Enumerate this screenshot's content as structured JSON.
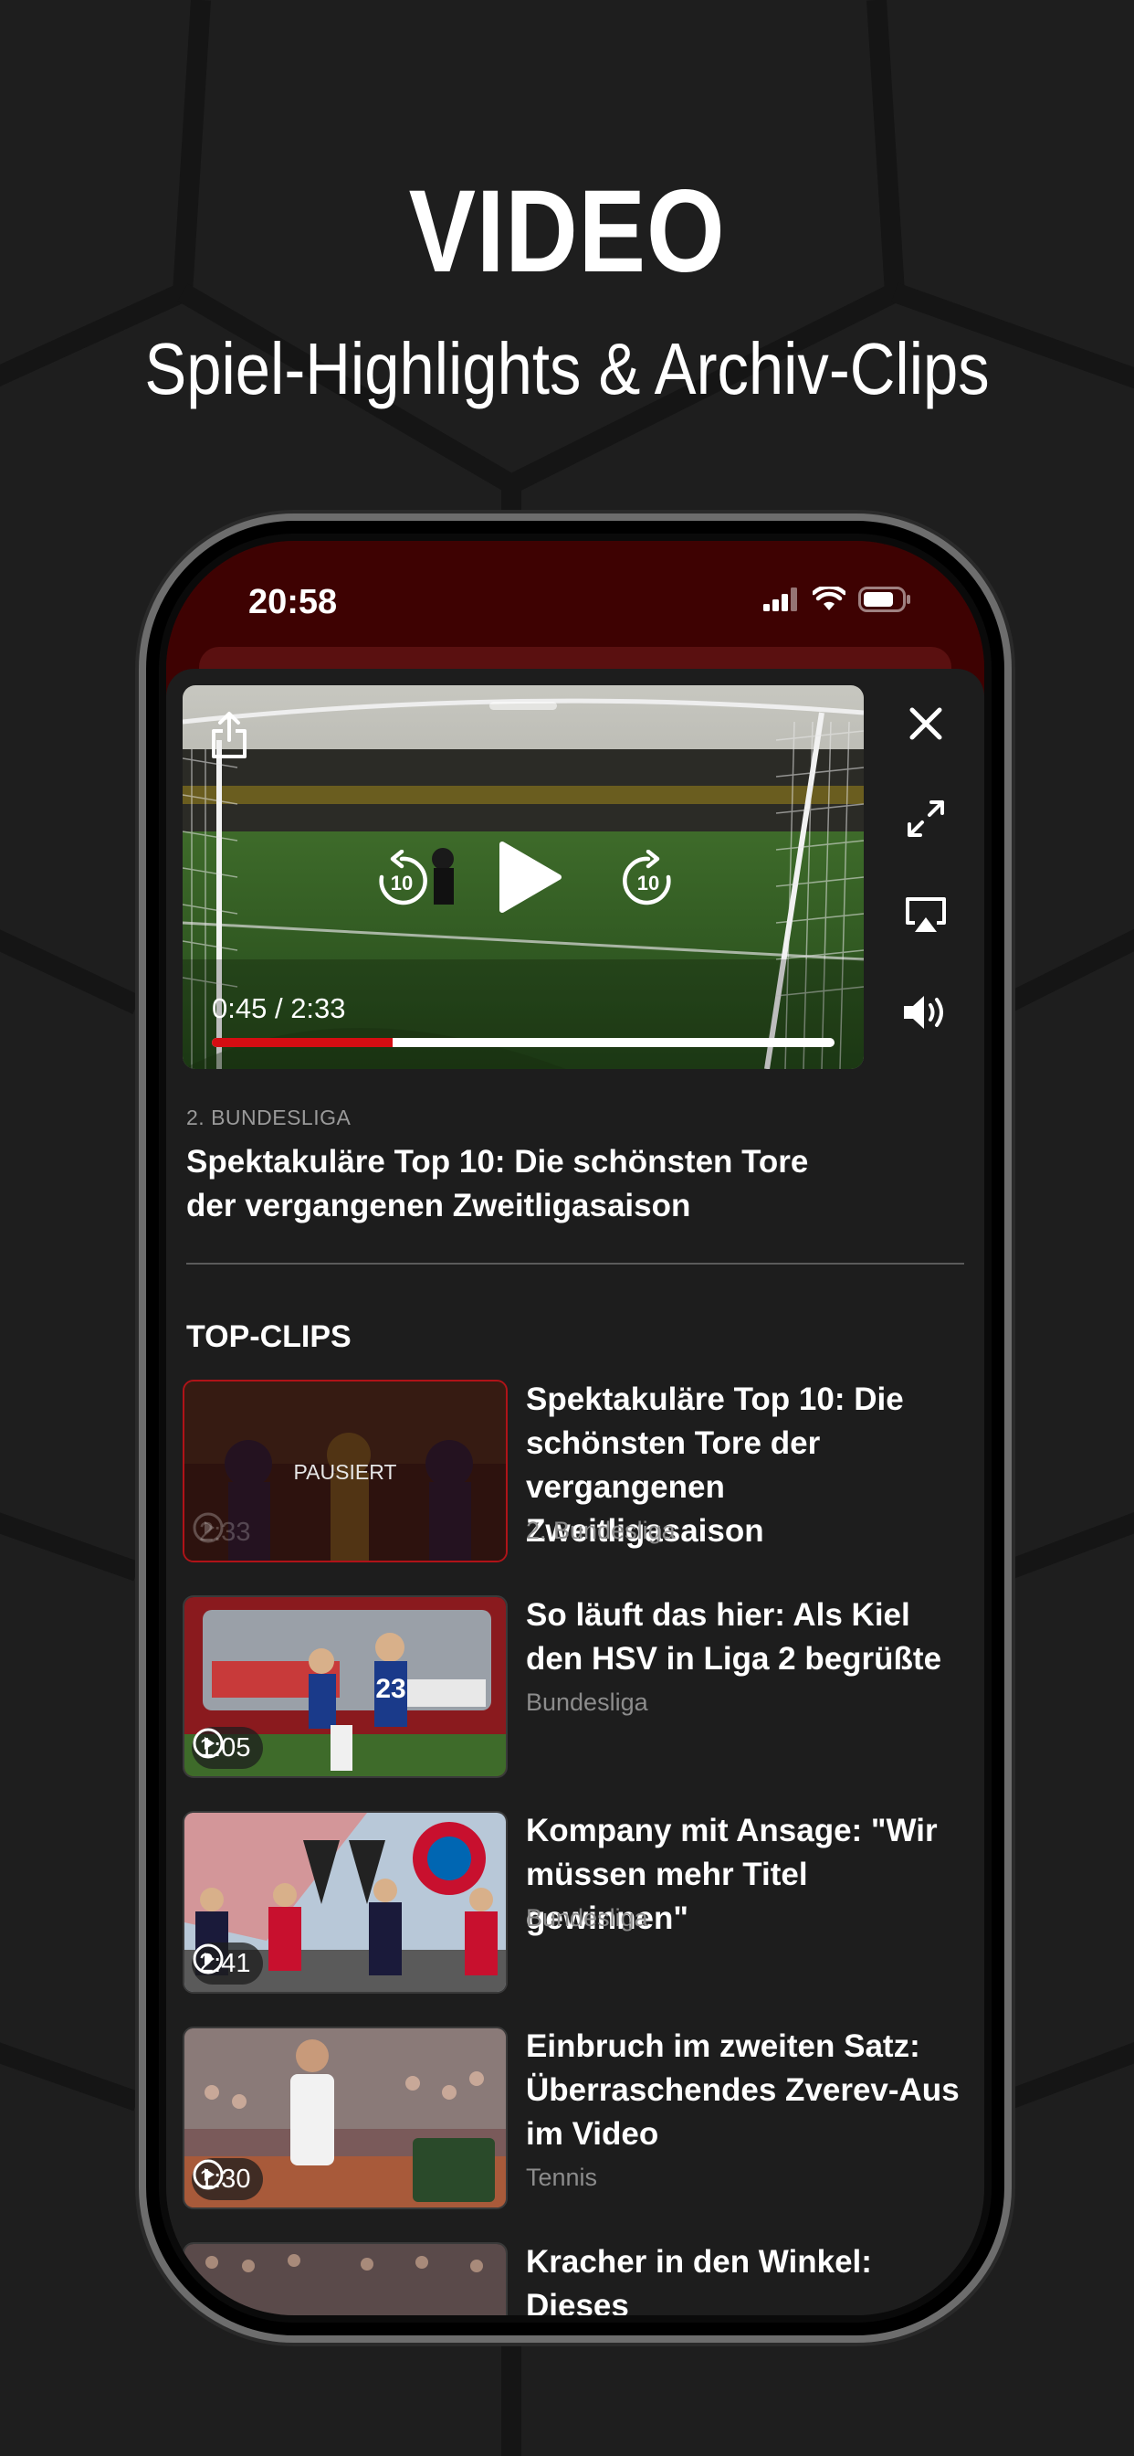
{
  "hero": {
    "title": "VIDEO",
    "subtitle": "Spiel-Highlights & Archiv-Clips"
  },
  "statusbar": {
    "time": "20:58",
    "icons": [
      "signal-icon",
      "wifi-icon",
      "battery-icon"
    ]
  },
  "player": {
    "current_time": "0:45",
    "duration": "/ 2:33",
    "progress": 0.29,
    "rewind_label": "10",
    "forward_label": "10",
    "league": "2. BUNDESLIGA",
    "title": "Spektakuläre Top 10: Die schönsten Tore der vergangenen Zweitligasaison",
    "side_icons": [
      "close-icon",
      "fullscreen-icon",
      "airplay-icon",
      "volume-icon"
    ]
  },
  "top_clips": {
    "heading": "TOP-CLIPS",
    "paused_label": "PAUSIERT",
    "items": [
      {
        "title": "Spektakuläre Top 10: Die schönsten Tore der vergangenen Zweitligasaison",
        "category": "2. Bundesliga",
        "duration": "2:33",
        "state": "paused"
      },
      {
        "title": "So läuft das hier: Als Kiel den HSV in Liga 2 begrüßte",
        "category": "Bundesliga",
        "duration": "1:05"
      },
      {
        "title": "Kompany mit Ansage: \"Wir müssen mehr Titel gewinnen\"",
        "category": "Bundesliga",
        "duration": "2:41"
      },
      {
        "title": "Einbruch im zweiten Satz: Überraschendes Zverev-Aus im Video",
        "category": "Tennis",
        "duration": "1:30"
      },
      {
        "title": "Kracher in den Winkel: Dieses",
        "category": "",
        "duration": ""
      }
    ]
  },
  "colors": {
    "accent": "#d40d12",
    "statusbar_bg": "#3e0202",
    "sheet_bg": "#1d1d1d"
  }
}
